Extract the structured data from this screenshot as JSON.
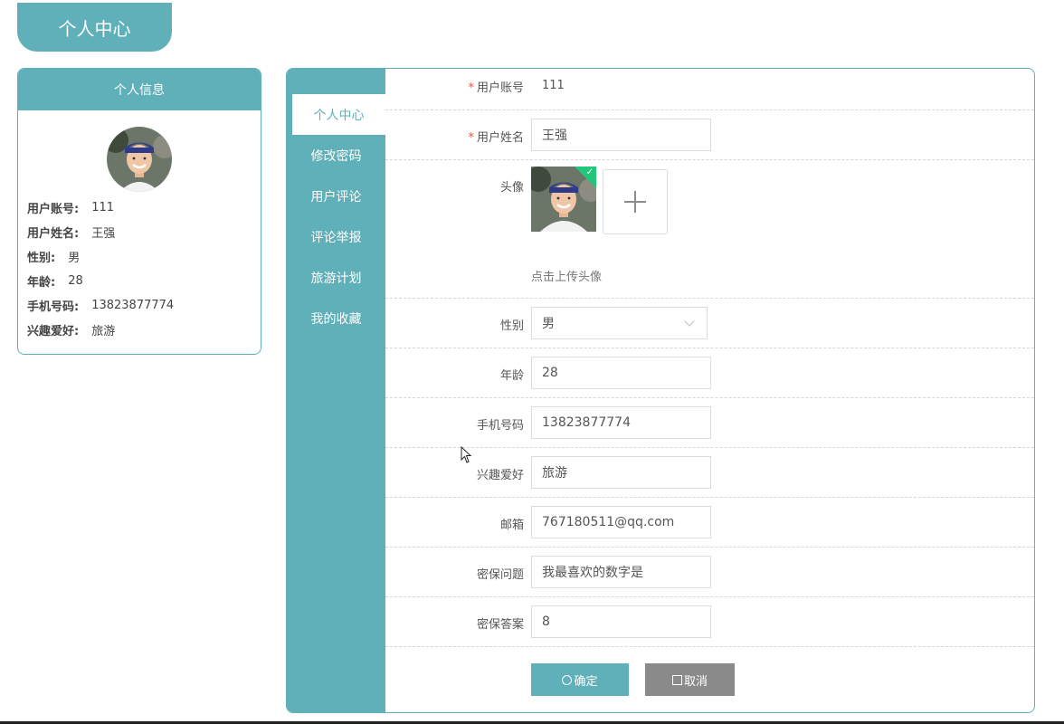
{
  "page": {
    "tab_title": "个人中心"
  },
  "profile_card": {
    "title": "个人信息",
    "fields": [
      {
        "key": "用户账号:",
        "value": "111"
      },
      {
        "key": "用户姓名:",
        "value": "王强"
      },
      {
        "key": "性别:",
        "value": "男"
      },
      {
        "key": "年龄:",
        "value": "28"
      },
      {
        "key": "手机号码:",
        "value": "13823877774"
      },
      {
        "key": "兴趣爱好:",
        "value": "旅游"
      }
    ]
  },
  "sidenav": {
    "items": [
      {
        "label": "个人中心",
        "active": true
      },
      {
        "label": "修改密码",
        "active": false
      },
      {
        "label": "用户评论",
        "active": false
      },
      {
        "label": "评论举报",
        "active": false
      },
      {
        "label": "旅游计划",
        "active": false
      },
      {
        "label": "我的收藏",
        "active": false
      }
    ]
  },
  "form": {
    "account": {
      "label": "用户账号",
      "required_mark": "*",
      "value": "111"
    },
    "name": {
      "label": "用户姓名",
      "required_mark": "*",
      "value": "王强"
    },
    "avatar": {
      "label": "头像",
      "hint": "点击上传头像"
    },
    "gender": {
      "label": "性别",
      "value": "男"
    },
    "age": {
      "label": "年龄",
      "value": "28"
    },
    "phone": {
      "label": "手机号码",
      "value": "13823877774"
    },
    "hobby": {
      "label": "兴趣爱好",
      "value": "旅游"
    },
    "email": {
      "label": "邮箱",
      "value": "767180511@qq.com"
    },
    "security_question": {
      "label": "密保问题",
      "value": "我最喜欢的数字是"
    },
    "security_answer": {
      "label": "密保答案",
      "value": "8"
    }
  },
  "buttons": {
    "confirm": "确定",
    "cancel": "取消"
  },
  "colors": {
    "accent": "#5fb0b8",
    "required": "#e05a4a",
    "success": "#23c77a",
    "cancel": "#8a8a8a"
  }
}
